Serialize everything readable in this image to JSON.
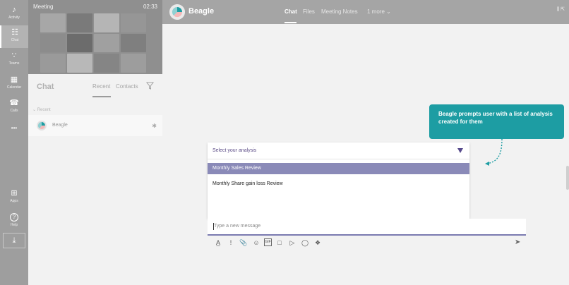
{
  "rail": {
    "items": [
      {
        "label": "Activity",
        "icon": "bell-icon",
        "glyph": "♪"
      },
      {
        "label": "Chat",
        "icon": "chat-icon",
        "glyph": "☷"
      },
      {
        "label": "Teams",
        "icon": "teams-icon",
        "glyph": "∵"
      },
      {
        "label": "Calendar",
        "icon": "calendar-icon",
        "glyph": "▦"
      },
      {
        "label": "Calls",
        "icon": "phone-icon",
        "glyph": "☎"
      },
      {
        "label": "...",
        "icon": "more-icon",
        "glyph": "•••"
      },
      {
        "label": "Apps",
        "icon": "apps-icon",
        "glyph": "⊞"
      },
      {
        "label": "Help",
        "icon": "help-icon",
        "glyph": "?"
      },
      {
        "label": "",
        "icon": "download-icon",
        "glyph": "⤓"
      }
    ]
  },
  "meeting": {
    "title": "Meeting",
    "time": "02:33"
  },
  "chat": {
    "title": "Chat",
    "tab_recent": "Recent",
    "tab_contacts": "Contacts",
    "recent_label": "Recent",
    "contacts": [
      {
        "name": "Beagle"
      }
    ]
  },
  "header": {
    "app_name": "Beagle",
    "tabs": [
      "Chat",
      "Files",
      "Meeting Notes",
      "1 more ⌄"
    ],
    "right_text": "⫼ ⇱"
  },
  "dropdown": {
    "placeholder": "Select your analysis",
    "options": [
      "Monthly Sales Review",
      "Monthly Share gain loss Review"
    ],
    "selected_index": 0
  },
  "compose": {
    "placeholder": "Type a new message",
    "toolbar_icons": [
      "format-icon",
      "important-icon",
      "attach-icon",
      "emoji-icon",
      "gif-icon",
      "sticker-icon",
      "meet-icon",
      "praise-icon",
      "more-apps-icon"
    ]
  },
  "callout": {
    "text": "Beagle prompts user with a list of analysis created for them"
  },
  "colors": {
    "accent": "#1d9da3",
    "dropdown_selected": "#8a8ab8",
    "dropdown_text": "#5b4b86"
  }
}
